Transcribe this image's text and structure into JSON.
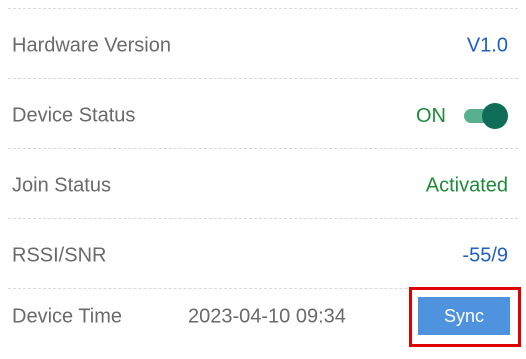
{
  "rows": {
    "hardware_version": {
      "label": "Hardware Version",
      "value": "V1.0"
    },
    "device_status": {
      "label": "Device Status",
      "value": "ON",
      "toggle_on": true
    },
    "join_status": {
      "label": "Join Status",
      "value": "Activated"
    },
    "rssi_snr": {
      "label": "RSSI/SNR",
      "value": "-55/9"
    },
    "device_time": {
      "label": "Device Time",
      "value": "2023-04-10 09:34",
      "button_label": "Sync"
    }
  },
  "colors": {
    "blue_value": "#1f5fbf",
    "green_value": "#1f8a3a",
    "toggle_track": "#57b08e",
    "toggle_knob": "#0f6d57",
    "sync_button": "#4f93df",
    "highlight": "#e10000"
  }
}
